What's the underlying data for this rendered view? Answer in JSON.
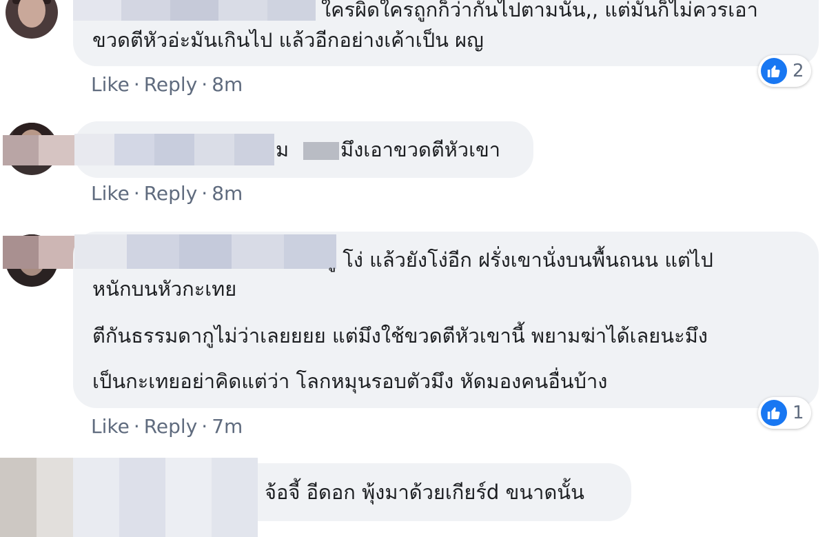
{
  "colors": {
    "bubble_bg": "#f0f2f5",
    "text": "#1c1e21",
    "action_text": "#5f6b7e",
    "like_blue": "#1877f2"
  },
  "comments": [
    {
      "text_lines": [
        "ใครผิดใครถูกก็ว่ากันไปตามนั้น,, แต่มันก็ไม่ควรเอา",
        "ขวดตีหัวอ่ะมันเกินไป แล้วอีกอย่างเค้าเป็น ผญ"
      ],
      "like_label": "Like",
      "reply_label": "Reply",
      "time": "8m",
      "reaction_icon": "like-icon",
      "reaction_count": "2"
    },
    {
      "text_lines": [
        "ม",
        "มึงเอาขวดตีหัวเขา"
      ],
      "like_label": "Like",
      "reply_label": "Reply",
      "time": "8m"
    },
    {
      "text_lines": [
        "ู โง่ แล้วยังโง่อีก ฝรั่งเขานั่งบนพื้นถนน แต่ไป",
        "หนักบนหัวกะเทย",
        "ตีกันธรรมดากูไม่ว่าเลยยยย แต่มึงใช้ขวดตีหัวเขานี้ พยามฆ่าได้เลยนะมึง",
        "เป็นกะเทยอย่าคิดแต่ว่า โลกหมุนรอบตัวมึง หัดมองคนอื่นบ้าง"
      ],
      "like_label": "Like",
      "reply_label": "Reply",
      "time": "7m",
      "reaction_icon": "like-icon",
      "reaction_count": "1"
    },
    {
      "text_lines": [
        "จ้อจี้ อีดอก พุ้งมาด้วยเกียร์d ขนาดนั้น"
      ]
    }
  ]
}
